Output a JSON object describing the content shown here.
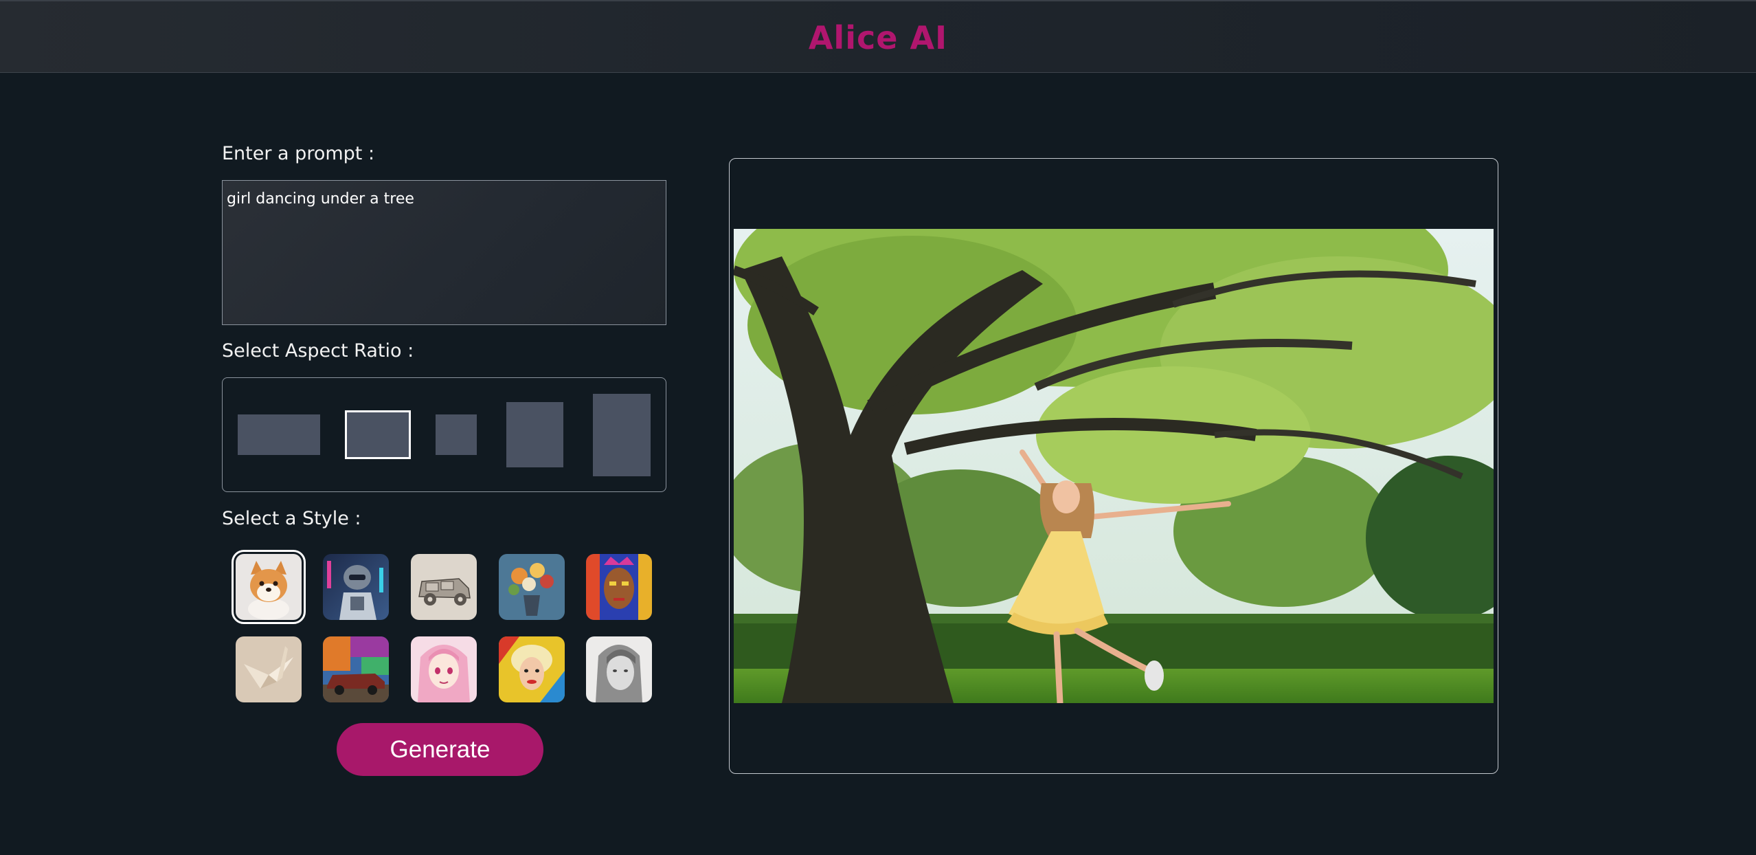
{
  "app": {
    "title": "Alice AI"
  },
  "prompt": {
    "label": "Enter a prompt :",
    "value": "girl dancing under a tree"
  },
  "aspect_ratio": {
    "label": "Select Aspect Ratio :",
    "options": [
      "wide",
      "landscape",
      "square",
      "portrait",
      "tall"
    ],
    "selected": "landscape"
  },
  "style": {
    "label": "Select a Style :",
    "options": [
      "3d-render",
      "cyberpunk",
      "sketch",
      "oil-painting",
      "pop-portrait",
      "origami",
      "graffiti",
      "anime",
      "pop-art",
      "pencil-drawing"
    ],
    "selected": "3d-render"
  },
  "actions": {
    "generate_label": "Generate"
  },
  "result": {
    "image": "girl dancing under a tree"
  },
  "colors": {
    "accent": "#b0166e",
    "button": "#a8186a",
    "background": "#111a21",
    "ratio_swatch": "#4a5262"
  }
}
